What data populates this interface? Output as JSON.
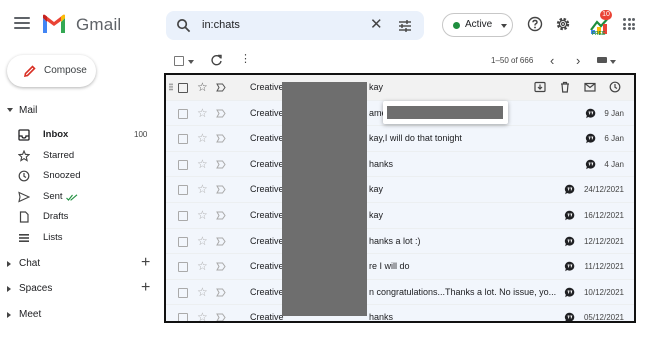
{
  "app": {
    "logo_text": "Gmail"
  },
  "search": {
    "query": "in:chats"
  },
  "status": {
    "label": "Active",
    "dot_color": "#1e8e3e"
  },
  "header_icons": [
    "help-icon",
    "gear-icon",
    "extension-badge-icon",
    "apps-grid-icon"
  ],
  "extension": {
    "count": "10",
    "label": "FREE"
  },
  "compose": {
    "label": "Compose"
  },
  "sidebar": {
    "mail_label": "Mail",
    "items": [
      {
        "label": "Inbox",
        "count": "100",
        "icon": "inbox-icon"
      },
      {
        "label": "Starred",
        "count": "",
        "icon": "star-icon"
      },
      {
        "label": "Snoozed",
        "count": "",
        "icon": "clock-icon"
      },
      {
        "label": "Sent",
        "count": "",
        "icon": "send-icon"
      },
      {
        "label": "Drafts",
        "count": "",
        "icon": "draft-icon"
      },
      {
        "label": "Lists",
        "count": "",
        "icon": "list-icon"
      }
    ],
    "chat_label": "Chat",
    "spaces_label": "Spaces",
    "meet_label": "Meet",
    "plus": "+"
  },
  "toolbar": {
    "range": "1–50 of 666",
    "more": "⋮",
    "prev": "‹",
    "next": "›"
  },
  "emails": [
    {
      "sender": "Creative",
      "snippet": "kay",
      "date": "",
      "chat": false
    },
    {
      "sender": "Creative",
      "snippet": "ame                                     ount No: 36892...",
      "date": "9 Jan",
      "chat": true
    },
    {
      "sender": "Creative",
      "snippet": "kay,I will do that tonight",
      "date": "6 Jan",
      "chat": true
    },
    {
      "sender": "Creative",
      "snippet": "hanks",
      "date": "4 Jan",
      "chat": true
    },
    {
      "sender": "Creative",
      "snippet": "kay",
      "date": "24/12/2021",
      "chat": true
    },
    {
      "sender": "Creative",
      "snippet": "kay",
      "date": "16/12/2021",
      "chat": true
    },
    {
      "sender": "Creative",
      "snippet": "hanks a lot :)",
      "date": "12/12/2021",
      "chat": true
    },
    {
      "sender": "Creative",
      "snippet": "re I will do",
      "date": "11/12/2021",
      "chat": true
    },
    {
      "sender": "Creative",
      "snippet": "n congratulations...Thanks a lot. No issue, yo...",
      "date": "10/12/2021",
      "chat": true
    },
    {
      "sender": "Creative",
      "snippet": "hanks",
      "date": "05/12/2021",
      "chat": true
    }
  ],
  "colors": {
    "accent_red": "#ea4335",
    "row_bg": "#f2f6fc",
    "redaction": "#6e6e6e"
  }
}
